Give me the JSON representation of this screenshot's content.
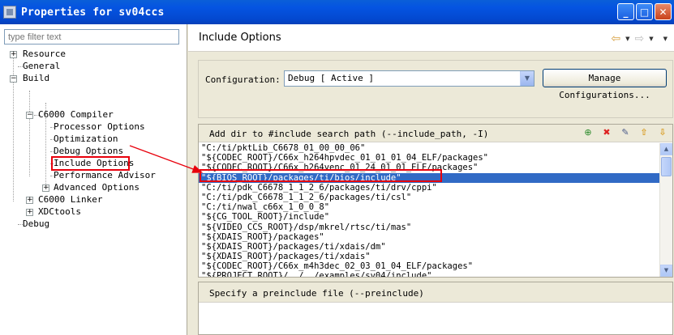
{
  "window": {
    "title": "Properties for sv04ccs"
  },
  "filter": {
    "placeholder": "type filter text"
  },
  "tree": {
    "resource": "Resource",
    "general": "General",
    "build": "Build",
    "c6000_compiler": "C6000 Compiler",
    "processor_options": "Processor Options",
    "optimization": "Optimization",
    "debug_options": "Debug Options",
    "include_options": "Include Options",
    "performance_advisor": "Performance Advisor",
    "advanced_options": "Advanced Options",
    "c6000_linker": "C6000 Linker",
    "xdctools": "XDCtools",
    "debug": "Debug"
  },
  "page": {
    "title": "Include Options"
  },
  "config": {
    "label": "Configuration:",
    "value": "Debug  [ Active ]",
    "manage_button": "Manage Configurations..."
  },
  "include_panel": {
    "title": "Add dir to #include search path (--include_path, -I)",
    "selected_index": 3,
    "items": [
      "\"C:/ti/pktLib_C6678_01_00_00_06\"",
      "\"${CODEC_ROOT}/C66x_h264hpvdec_01_01_01_04_ELF/packages\"",
      "\"${CODEC_ROOT}/C66x_h264venc_01_24_01_01_ELF/packages\"",
      "\"${BIOS_ROOT}/packages/ti/bios/include\"",
      "\"C:/ti/pdk_C6678_1_1_2_6/packages/ti/drv/cppi\"",
      "\"C:/ti/pdk_C6678_1_1_2_6/packages/ti/csl\"",
      "\"C:/ti/nwal_c66x_1_0_0_8\"",
      "\"${CG_TOOL_ROOT}/include\"",
      "\"${VIDEO_CCS_ROOT}/dsp/mkrel/rtsc/ti/mas\"",
      "\"${XDAIS_ROOT}/packages\"",
      "\"${XDAIS_ROOT}/packages/ti/xdais/dm\"",
      "\"${XDAIS_ROOT}/packages/ti/xdais\"",
      "\"${CODEC_ROOT}/C66x_m4h3dec_02_03_01_04_ELF/packages\"",
      "\"${PROJECT_ROOT}/../../examples/sv04/include\""
    ]
  },
  "preinclude_panel": {
    "title": "Specify a preinclude file (--preinclude)"
  },
  "colors": {
    "annotation": "#e8000c",
    "selection": "#316ac5",
    "titlebar": "#0554e2"
  }
}
